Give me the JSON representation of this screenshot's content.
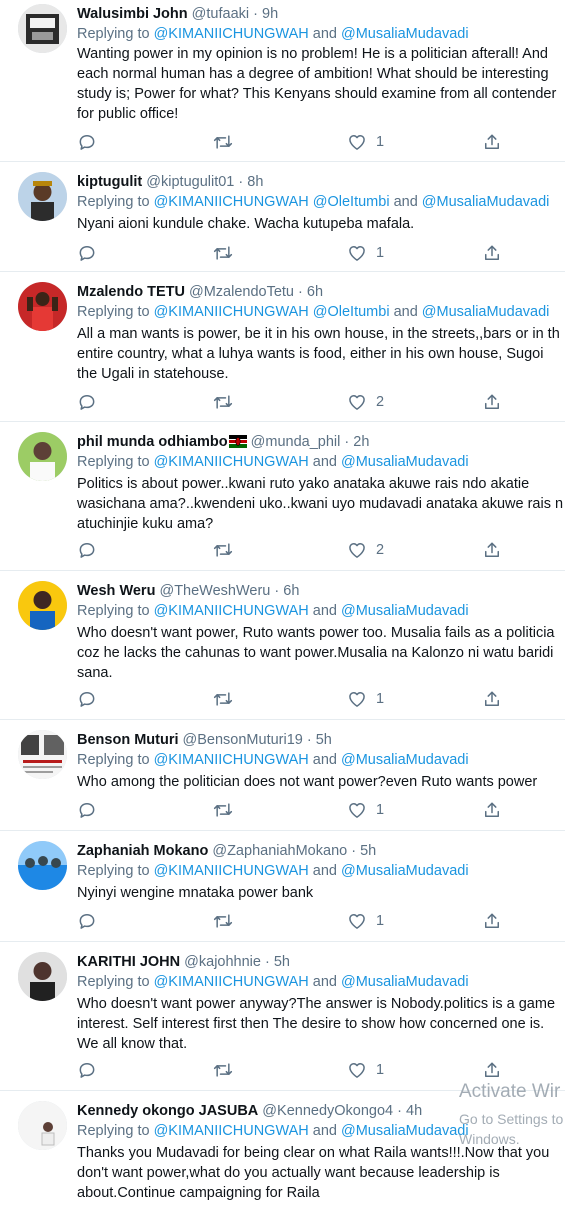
{
  "tweets": [
    {
      "name": "Walusimbi John",
      "handle": "@tufaaki",
      "time": "9h",
      "replying_prefix": "Replying to ",
      "mention1": "@KIMANIICHUNGWAH",
      "joiner": " and ",
      "mention2": "@MusaliaMudavadi",
      "text": "Wanting power in my opinion is no problem! He is a politician afterall! And\neach normal human has a degree of ambition! What should be interesting\nstudy is; Power for what? This Kenyans should examine from all contender\nfor public office!",
      "likes": "1"
    },
    {
      "name": "kiptugulit",
      "handle": "@kiptugulit01",
      "time": "8h",
      "replying_prefix": "Replying to ",
      "mention1": "@KIMANIICHUNGWAH",
      "mention_mid": "@OleItumbi",
      "joiner": " and ",
      "mention2": "@MusaliaMudavadi",
      "text": "Nyani aioni kundule chake. Wacha kutupeba mafala.",
      "likes": "1"
    },
    {
      "name": "Mzalendo TETU",
      "handle": "@MzalendoTetu",
      "time": "6h",
      "replying_prefix": "Replying to ",
      "mention1": "@KIMANIICHUNGWAH",
      "mention_mid": "@OleItumbi",
      "joiner": " and ",
      "mention2": "@MusaliaMudavadi",
      "text": "All a man wants is power, be it in his own house, in the streets,,bars or in th\nentire  country, what a luhya wants is food, either in his own house, Sugoi\nthe Ugali in statehouse.",
      "likes": "2"
    },
    {
      "name": "phil munda odhiambo",
      "handle": "@munda_phil",
      "time": "2h",
      "replying_prefix": "Replying to ",
      "mention1": "@KIMANIICHUNGWAH",
      "joiner": " and ",
      "mention2": "@MusaliaMudavadi",
      "text": "Politics is about power..kwani ruto yako anataka akuwe rais ndo akatie\nwasichana ama?..kwendeni uko..kwani uyo mudavadi anataka akuwe rais n\natuchinjie kuku ama?",
      "likes": "2"
    },
    {
      "name": "Wesh Weru",
      "handle": "@TheWeshWeru",
      "time": "6h",
      "replying_prefix": "Replying to ",
      "mention1": "@KIMANIICHUNGWAH",
      "joiner": " and ",
      "mention2": "@MusaliaMudavadi",
      "text": "Who doesn't want power, Ruto wants power too. Musalia fails as a politicia\ncoz he lacks the cahunas to want power.Musalia na Kalonzo ni watu baridi\nsana.",
      "likes": "1"
    },
    {
      "name": "Benson Muturi",
      "handle": "@BensonMuturi19",
      "time": "5h",
      "replying_prefix": "Replying to ",
      "mention1": "@KIMANIICHUNGWAH",
      "joiner": " and ",
      "mention2": "@MusaliaMudavadi",
      "text": "Who among the politician does not want power?even Ruto wants power",
      "likes": "1"
    },
    {
      "name": "Zaphaniah Mokano",
      "handle": "@ZaphaniahMokano",
      "time": "5h",
      "replying_prefix": "Replying to ",
      "mention1": "@KIMANIICHUNGWAH",
      "joiner": " and ",
      "mention2": "@MusaliaMudavadi",
      "text": "Nyinyi wengine mnataka power bank",
      "likes": "1"
    },
    {
      "name": "KARITHI JOHN",
      "handle": "@kajohhnie",
      "time": "5h",
      "replying_prefix": "Replying to ",
      "mention1": "@KIMANIICHUNGWAH",
      "joiner": " and ",
      "mention2": "@MusaliaMudavadi",
      "text": "Who doesn't want power anyway?The answer is Nobody.politics is a game\ninterest. Self interest first then The desire to show how concerned one is.\nWe all know that.",
      "likes": "1"
    },
    {
      "name": "Kennedy okongo JASUBA",
      "handle": "@KennedyOkongo4",
      "time": "4h",
      "replying_prefix": "Replying to ",
      "mention1": "@KIMANIICHUNGWAH",
      "joiner": " and ",
      "mention2": "@MusaliaMudavadi",
      "text": "Thanks you Mudavadi for being clear on what Raila wants!!!.Now that you\ndon't want power,what do you actually want because leadership is\nabout.Continue campaigning for Raila",
      "likes": ""
    }
  ],
  "separator_dot": " · ",
  "watermark": {
    "title": "Activate Wir",
    "line1": "Go to Settings to",
    "line2": "Windows."
  },
  "icons": {
    "reply": "reply-icon",
    "retweet": "retweet-icon",
    "like": "like-icon",
    "share": "share-icon",
    "flag": "kenya-flag-icon"
  },
  "colors": {
    "mention": "#1b95e0",
    "secondary_text": "#5b7083",
    "primary_text": "#0f1419",
    "divider": "#e6ecf0"
  }
}
